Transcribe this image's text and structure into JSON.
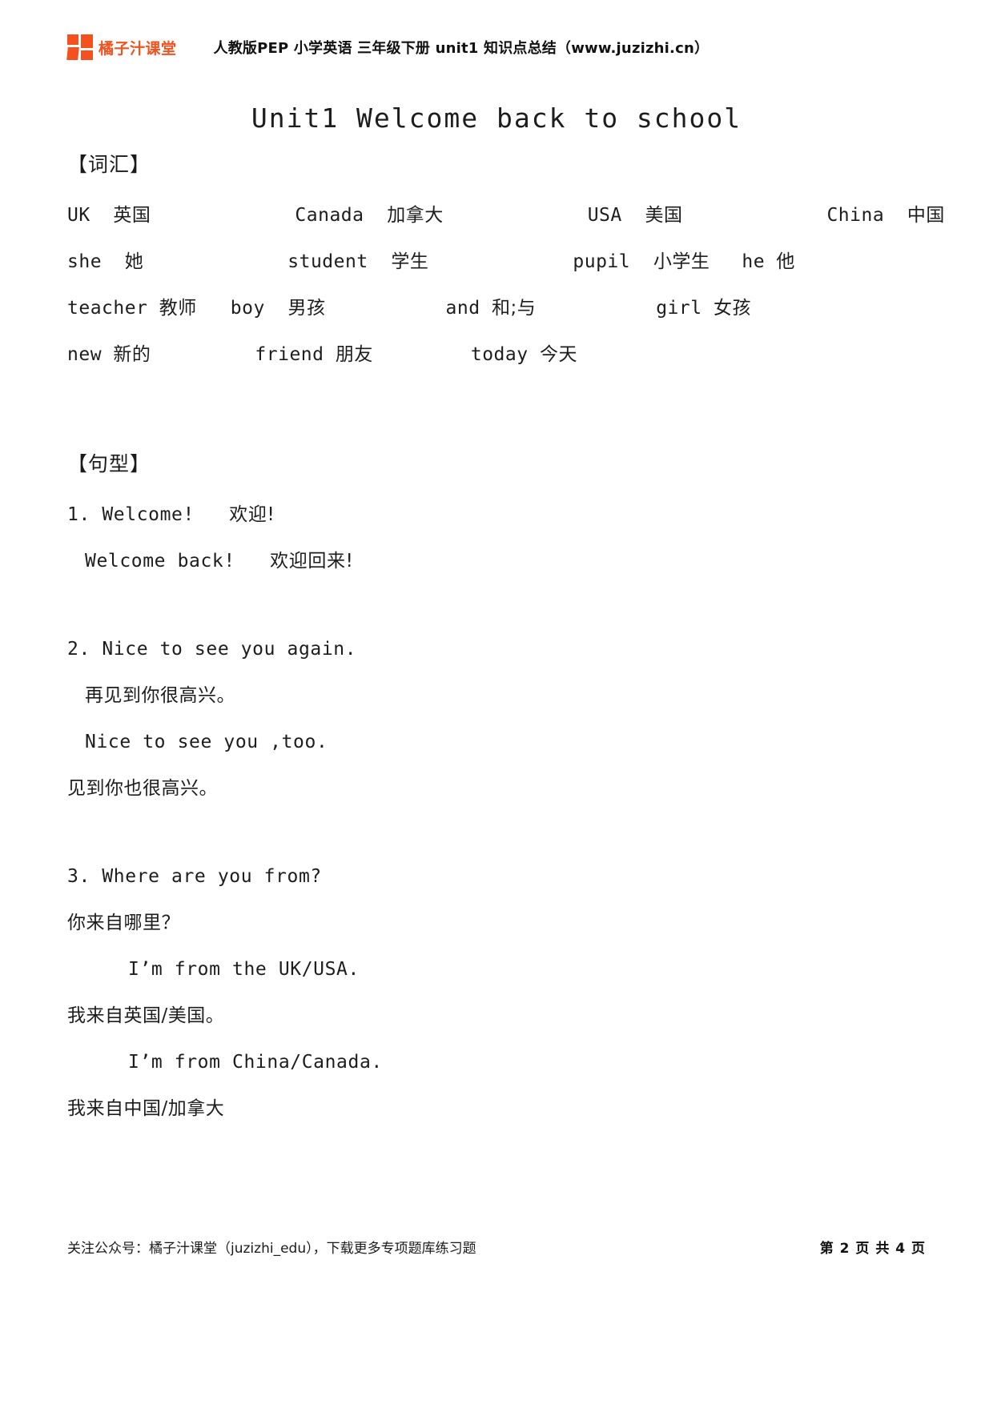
{
  "header": {
    "brand_name": "橘子汁课堂",
    "logo_color": "#f4511e",
    "title": "人教版PEP 小学英语 三年级下册  unit1 知识点总结（www.juzizhi.cn）"
  },
  "doc_title": "Unit1 Welcome back to school",
  "sections": {
    "vocabulary_heading": "【词汇】",
    "sentence_heading": "【句型】"
  },
  "vocabulary": {
    "rows": [
      [
        {
          "en": "UK",
          "cn": "英国"
        },
        {
          "en": "Canada",
          "cn": "加拿大"
        },
        {
          "en": "USA",
          "cn": "美国"
        },
        {
          "en": "China",
          "cn": "中国"
        }
      ],
      [
        {
          "en": "she",
          "cn": "她"
        },
        {
          "en": "student",
          "cn": "学生"
        },
        {
          "en": "pupil",
          "cn": "小学生"
        },
        {
          "en": "he",
          "cn": "他"
        }
      ],
      [
        {
          "en": "teacher",
          "cn": "教师"
        },
        {
          "en": "boy",
          "cn": "男孩"
        },
        {
          "en": "and",
          "cn": "和;与"
        },
        {
          "en": "girl",
          "cn": "女孩"
        }
      ],
      [
        {
          "en": "new",
          "cn": "新的"
        },
        {
          "en": "friend",
          "cn": "朋友"
        },
        {
          "en": "today",
          "cn": "今天"
        }
      ]
    ]
  },
  "sentences": [
    {
      "number": "1.",
      "en": "Welcome!",
      "cn": "欢迎!",
      "extra_en": "Welcome  back!",
      "extra_cn": "欢迎回来!"
    },
    {
      "number": "2.",
      "en": "Nice to see you again.",
      "cn": "再见到你很高兴。",
      "extra_en": "Nice to see you ,too.",
      "extra_cn": "见到你也很高兴。"
    },
    {
      "number": "3.",
      "en": "Where are you from?",
      "cn": "你来自哪里？",
      "answer1_en": "I’m from the UK/USA.",
      "answer1_cn": "我来自英国/美国。",
      "answer2_en": "I’m from China/Canada.",
      "answer2_cn": "我来自中国/加拿大"
    }
  ],
  "footer": {
    "note": "关注公众号：橘子汁课堂（juzizhi_edu），下载更多专项题库练习题",
    "page_label": "第 2 页 共 4 页"
  }
}
